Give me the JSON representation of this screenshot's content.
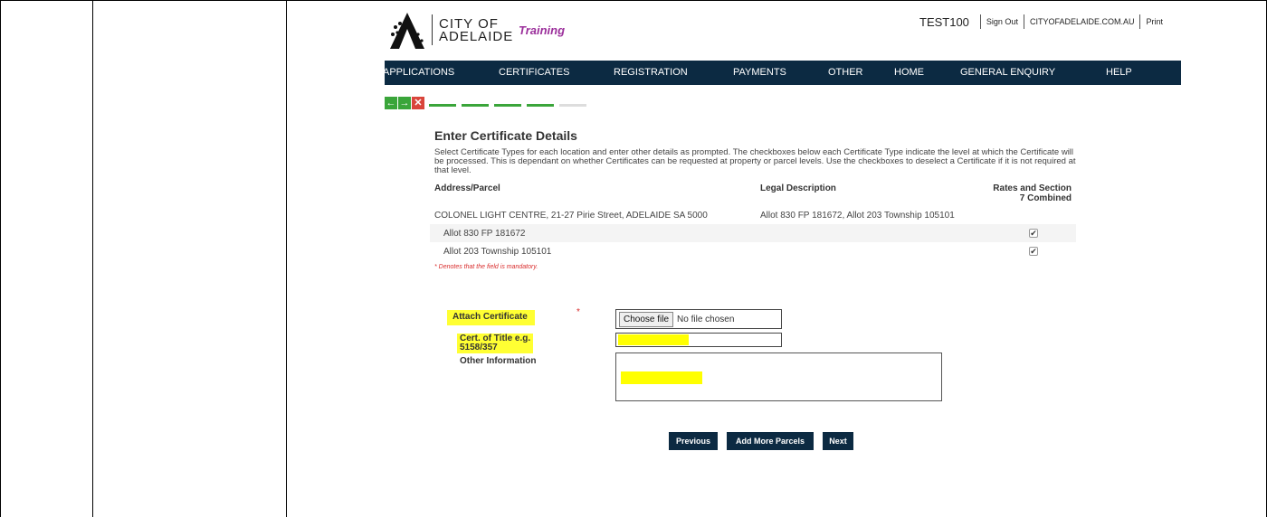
{
  "header": {
    "logo_line1": "CITY OF",
    "logo_line2": "ADELAIDE",
    "environment": "Training",
    "user": "TEST100",
    "sign_out": "Sign Out",
    "site_link": "CITYOFADELAIDE.COM.AU",
    "print": "Print"
  },
  "nav": {
    "items": [
      "APPLICATIONS",
      "CERTIFICATES",
      "REGISTRATION",
      "PAYMENTS",
      "OTHER",
      "HOME",
      "GENERAL ENQUIRY",
      "HELP"
    ]
  },
  "progress": {
    "total_steps": 5,
    "completed_steps": 4
  },
  "content": {
    "title": "Enter Certificate Details",
    "description": "Select Certificate Types for each location and enter other details as prompted. The checkboxes below each Certificate Type indicate the level at which the Certificate will be processed. This is dependant on whether Certificates can be requested at property or parcel levels. Use the checkboxes to deselect a Certificate if it is not required at that level.",
    "table": {
      "headers": [
        "Address/Parcel",
        "Legal Description",
        "Rates and Section 7 Combined"
      ],
      "rows": [
        {
          "address": "COLONEL LIGHT CENTRE, 21-27 Pirie Street, ADELAIDE SA 5000",
          "legal": "Allot 830 FP 181672, Allot 203 Township 105101",
          "checked": null
        },
        {
          "address": "Allot 830 FP 181672",
          "legal": "",
          "checked": true
        },
        {
          "address": "Allot 203 Township 105101",
          "legal": "",
          "checked": true
        }
      ]
    },
    "mandatory_note": "* Denotes that the field is mandatory."
  },
  "form": {
    "attach_label": "Attach Certificate",
    "attach_required": "*",
    "choose_file": "Choose file",
    "no_file": "No file chosen",
    "title_label_1": "Cert. of Title e.g.",
    "title_label_2": "5158/357",
    "other_label": "Other Information"
  },
  "buttons": {
    "previous": "Previous",
    "add_more": "Add More Parcels",
    "next": "Next"
  }
}
